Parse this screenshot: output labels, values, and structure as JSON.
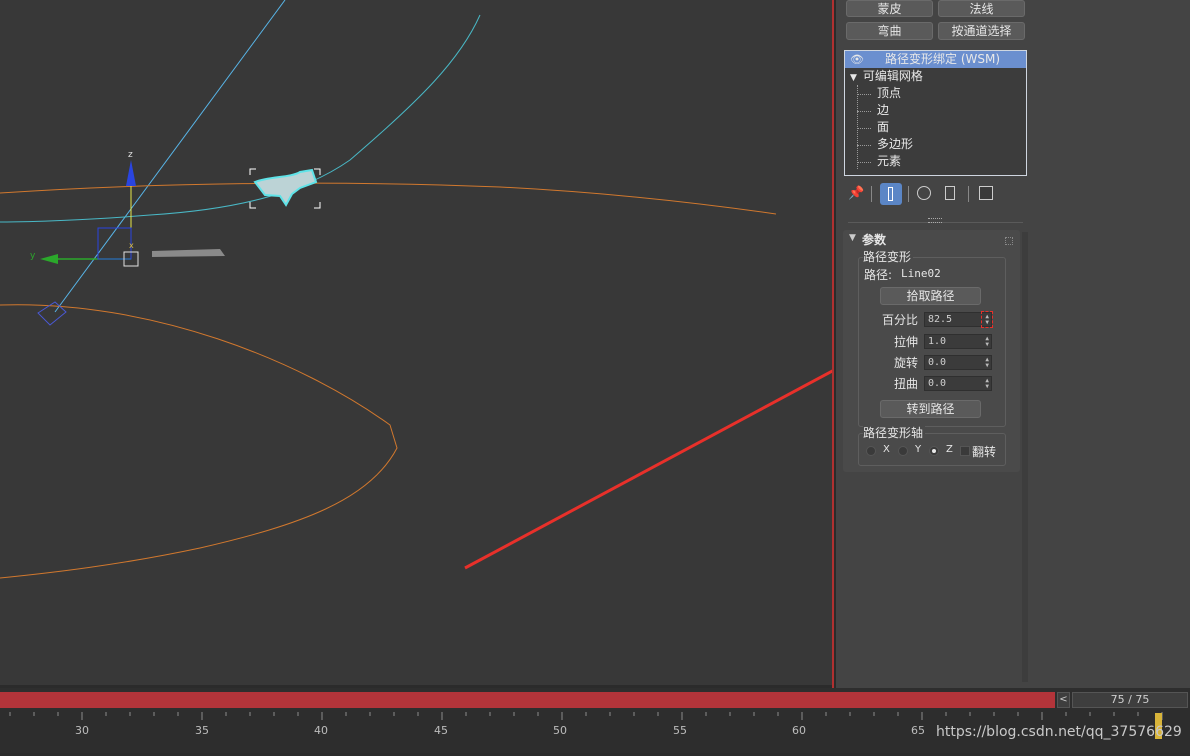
{
  "modifier_buttons": [
    "蒙皮",
    "法线",
    "弯曲",
    "按通道选择"
  ],
  "modifier_stack": {
    "top_item": "路径变形绑定 (WSM)",
    "base_item": "可编辑网格",
    "sub_items": [
      "顶点",
      "边",
      "面",
      "多边形",
      "元素"
    ]
  },
  "rollout": {
    "title": "参数",
    "group1_title": "路径变形",
    "path_label": "路径:",
    "path_value": "Line02",
    "pick_path_button": "拾取路径",
    "params": [
      {
        "label": "百分比",
        "value": "82.5"
      },
      {
        "label": "拉伸",
        "value": "1.0"
      },
      {
        "label": "旋转",
        "value": "0.0"
      },
      {
        "label": "扭曲",
        "value": "0.0"
      }
    ],
    "move_to_path_button": "转到路径",
    "axis_group_title": "路径变形轴",
    "axes": [
      "X",
      "Y",
      "Z"
    ],
    "selected_axis": "Z",
    "flip_label": "翻转"
  },
  "gizmo_labels": {
    "z": "z",
    "y": "y",
    "x": "x"
  },
  "timeline": {
    "frame_display": "75 / 75",
    "nav_left": "<",
    "ticks": [
      "30",
      "35",
      "40",
      "45",
      "50",
      "55",
      "60",
      "65"
    ]
  },
  "watermark": "https://blog.csdn.net/qq_37576629",
  "colors": {
    "accent_red": "#e8302a",
    "selection_cyan": "#5fe3e8",
    "spline_orange": "#d1782e"
  }
}
